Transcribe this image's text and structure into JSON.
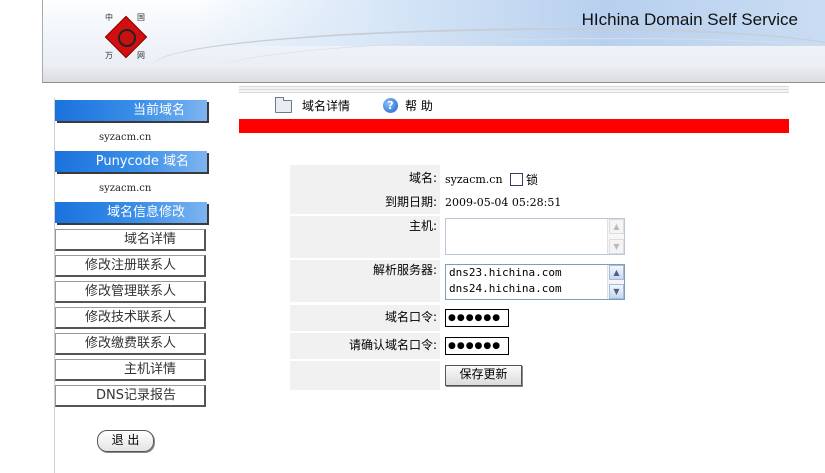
{
  "header": {
    "site_title": "HIchina Domain Self Service",
    "logo_chars": [
      "中",
      "国",
      "万",
      "网"
    ]
  },
  "sidebar": {
    "current_domain_title": "当前域名",
    "current_domain": "syzacm.cn",
    "punycode_title": "Punycode 域名",
    "punycode_domain": "syzacm.cn",
    "modify_title": "域名信息修改",
    "menu": [
      {
        "label": "域名详情"
      },
      {
        "label": "修改注册联系人"
      },
      {
        "label": "修改管理联系人"
      },
      {
        "label": "修改技术联系人"
      },
      {
        "label": "修改缴费联系人"
      },
      {
        "label": "主机详情"
      },
      {
        "label": "DNS记录报告"
      }
    ],
    "logout_label": "退 出"
  },
  "toolbar": {
    "details_label": "域名详情",
    "help_label": "帮 助"
  },
  "form": {
    "domain_label": "域名:",
    "domain_value": "syzacm.cn",
    "lock_label": "锁",
    "lock_checked": false,
    "expiry_label": "到期日期:",
    "expiry_value": "2009-05-04 05:28:51",
    "host_label": "主机:",
    "host_value": "",
    "ns_label": "解析服务器:",
    "ns_values": [
      "dns23.hichina.com",
      "dns24.hichina.com"
    ],
    "password_label": "域名口令:",
    "password_mask": "●●●●●●",
    "confirm_label": "请确认域名口令:",
    "confirm_mask": "●●●●●●",
    "save_label": "保存更新"
  },
  "colors": {
    "accent_blue": "#1a72dd",
    "red_bar": "#ff0000"
  }
}
